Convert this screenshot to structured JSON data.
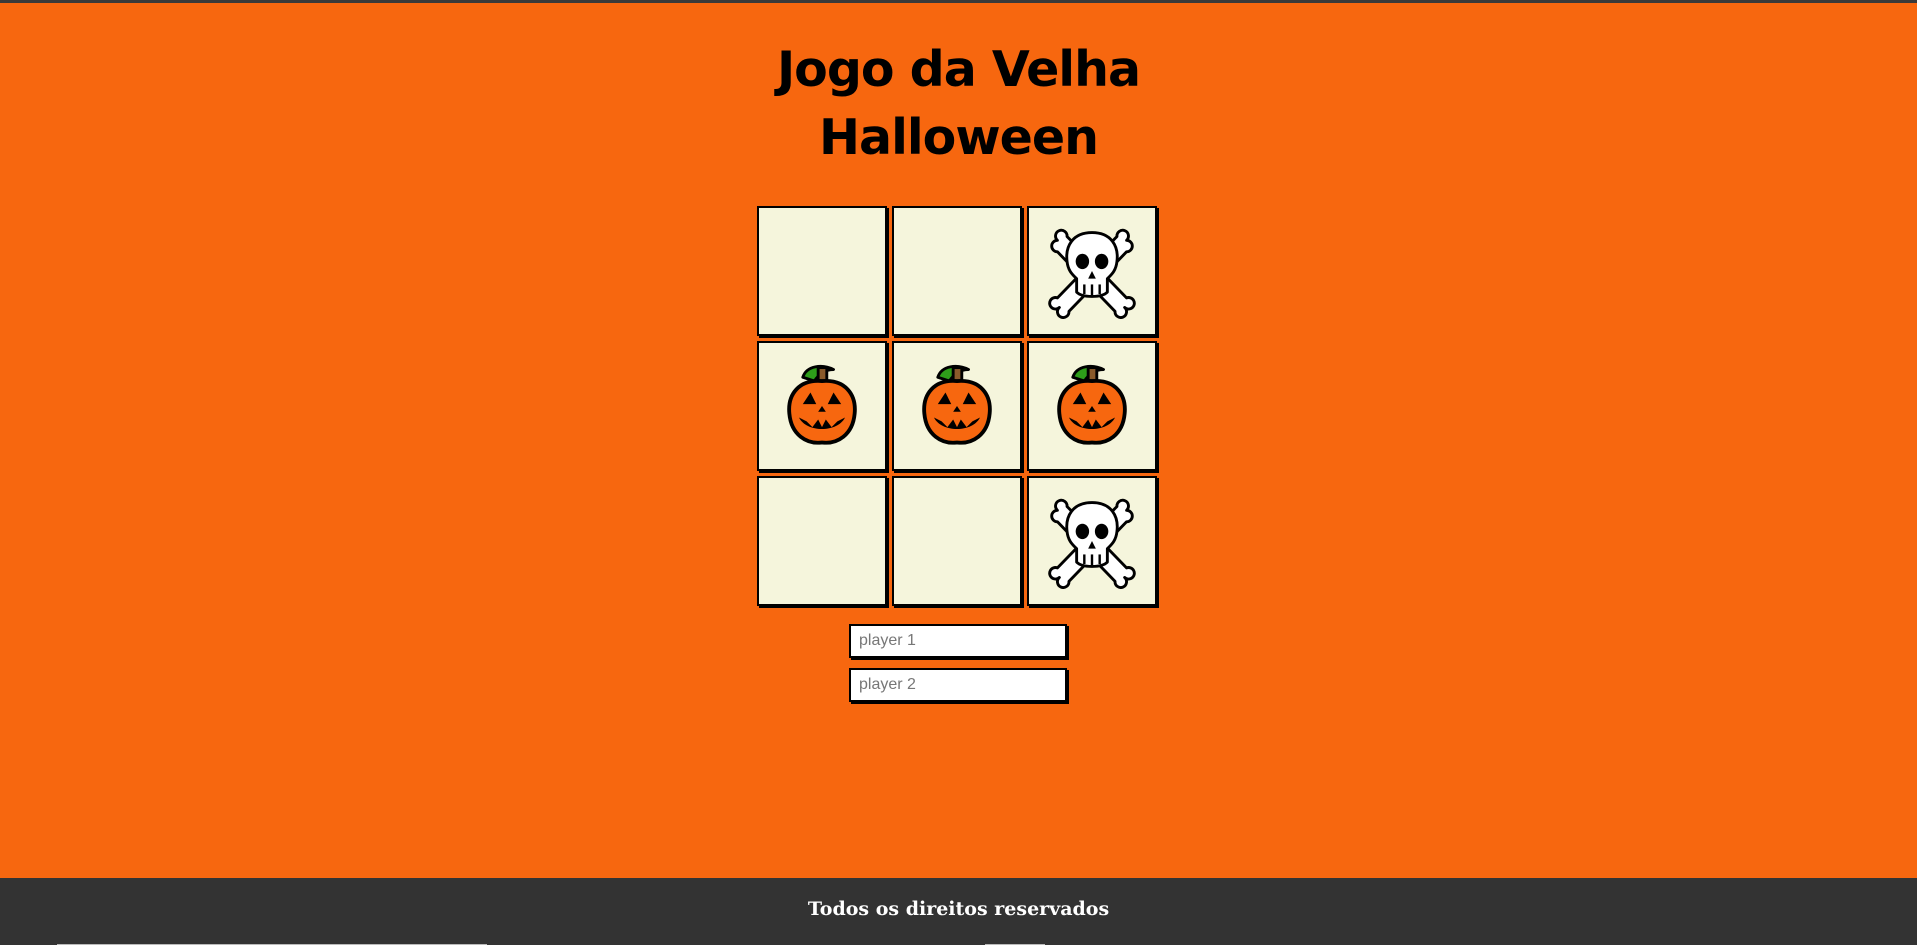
{
  "game": {
    "title_line1": "Jogo da Velha",
    "title_line2": "Halloween",
    "board": [
      "",
      "",
      "skull",
      "pumpkin",
      "pumpkin",
      "pumpkin",
      "",
      "",
      "skull"
    ]
  },
  "players": {
    "player1_placeholder": "player 1",
    "player2_placeholder": "player 2",
    "player1_value": "",
    "player2_value": ""
  },
  "footer": {
    "text": "Todos os direitos reservados"
  },
  "icons": {
    "skull": "skull-and-crossbones-icon",
    "pumpkin": "jack-o-lantern-icon"
  },
  "colors": {
    "background": "#f7670f",
    "cell": "#f5f5dc",
    "footer": "#333333",
    "pumpkin": "#f7670f",
    "leaf": "#2e9e1a"
  }
}
